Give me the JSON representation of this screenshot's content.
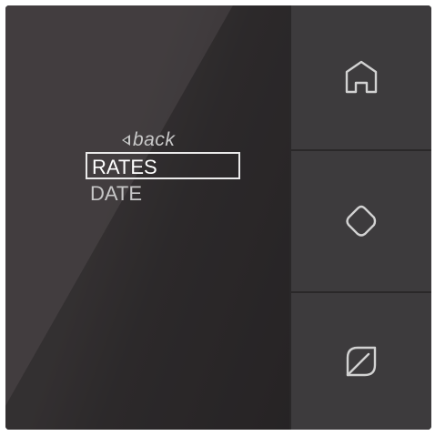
{
  "menu": {
    "back_label": "back",
    "items": [
      "RATES",
      "DATE"
    ],
    "selected_index": 0
  },
  "buttons": [
    {
      "icon": "home-icon"
    },
    {
      "icon": "diamond-icon"
    },
    {
      "icon": "leaf-icon"
    }
  ],
  "colors": {
    "device": "#3b393b",
    "text": "#e8e8e8",
    "highlight_border": "#eaeaea"
  }
}
